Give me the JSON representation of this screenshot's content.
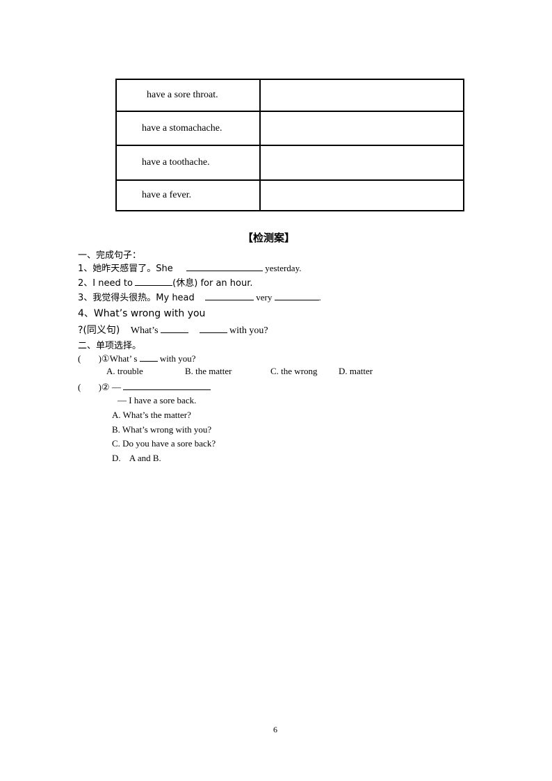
{
  "table": {
    "rows": [
      {
        "col1": "have a sore throat.",
        "col2": ""
      },
      {
        "col1": "have a stomachache.",
        "col2": ""
      },
      {
        "col1": "have a toothache.",
        "col2": ""
      },
      {
        "col1": "have a fever.",
        "col2": ""
      }
    ]
  },
  "section_title": "【检测案】",
  "part1": {
    "heading": "一、完成句子：",
    "q1": {
      "prefix": "1、她昨天感冒了。She",
      "suffix": "yesterday."
    },
    "q2": {
      "prefix": "2、I need to",
      "suffix": "(休息) for an hour."
    },
    "q3": {
      "prefix": "3、我觉得头很热。My head",
      "middle": "very",
      "suffix": "."
    },
    "q4": {
      "line1": "4、What’s wrong with you",
      "prefix": "?(同义句)",
      "word": "What’s",
      "suffix": "with you?"
    }
  },
  "part2": {
    "heading": "二、单项选择。",
    "q1": {
      "paren": "(",
      "close": ")①What’ s",
      "suffix": "with you?",
      "options": [
        "A. trouble",
        "B. the matter",
        "C. the wrong",
        "D. matter"
      ]
    },
    "q2": {
      "paren": "(",
      "close": ")② —",
      "reply": "— I have a sore back.",
      "options": [
        "A. What’s the matter?",
        "B. What’s wrong with you?",
        "C. Do you have a sore back?",
        "D.    A and B."
      ]
    }
  },
  "page_number": "6"
}
